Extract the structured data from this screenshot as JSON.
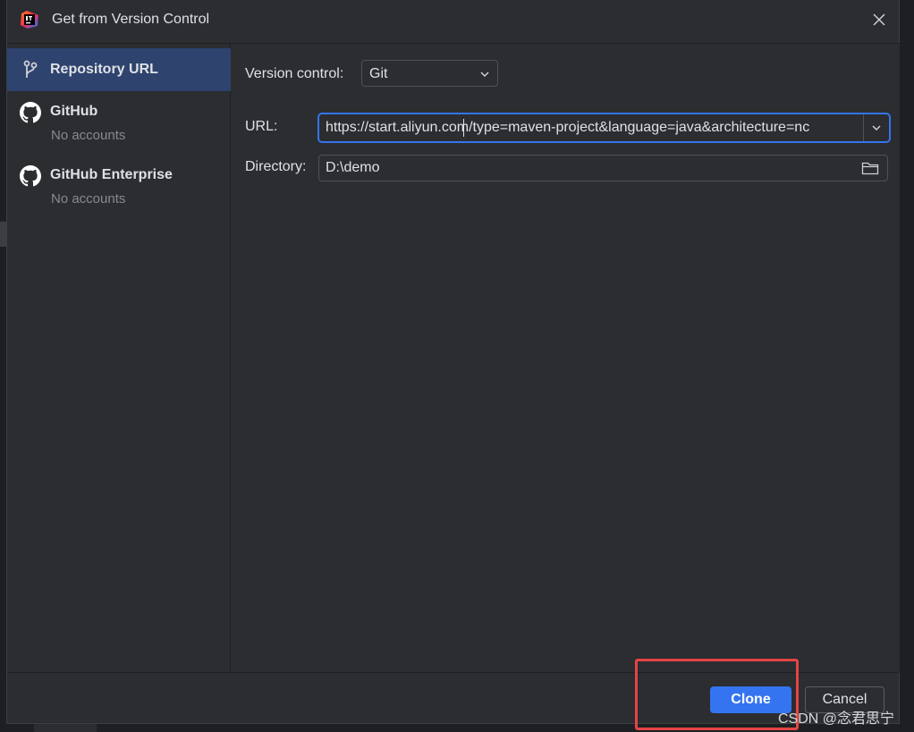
{
  "window": {
    "title": "Get from Version Control",
    "app_icon": "intellij-idea-icon",
    "close_icon": "close-icon"
  },
  "sidebar": {
    "items": [
      {
        "label": "Repository URL",
        "sub": "",
        "icon": "git-branch-icon",
        "selected": true
      },
      {
        "label": "GitHub",
        "sub": "No accounts",
        "icon": "github-icon",
        "selected": false
      },
      {
        "label": "GitHub Enterprise",
        "sub": "No accounts",
        "icon": "github-icon",
        "selected": false
      }
    ]
  },
  "form": {
    "version_control_label": "Version control:",
    "version_control_value": "Git",
    "url_label": "URL:",
    "url_value": "https://start.aliyun.com/type=maven-project&language=java&architecture=nc",
    "directory_label": "Directory:",
    "directory_value": "D:\\demo"
  },
  "footer": {
    "clone_label": "Clone",
    "cancel_label": "Cancel"
  },
  "watermark": "CSDN @念君思宁",
  "colors": {
    "background": "#2b2d30",
    "accent": "#3574f0",
    "selected_item": "#2e436e",
    "highlight": "#e34545"
  }
}
